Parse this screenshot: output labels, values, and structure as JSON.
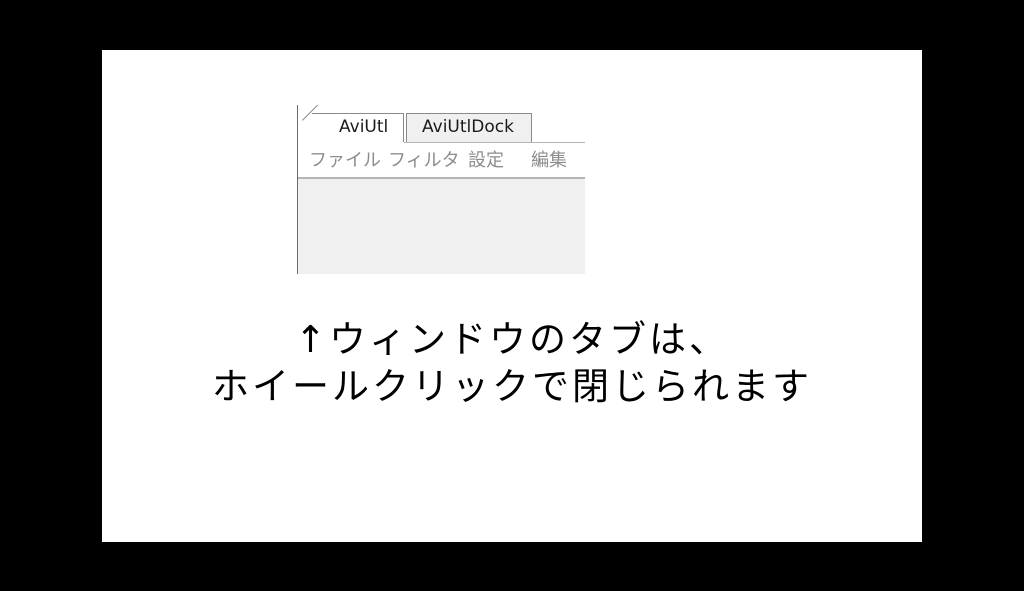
{
  "window": {
    "tabs": [
      {
        "label": "AviUtl",
        "active": true
      },
      {
        "label": "AviUtlDock",
        "active": false
      }
    ]
  },
  "menu": {
    "items": [
      {
        "label": "ファイル"
      },
      {
        "label": "フィルタ"
      },
      {
        "label": "設定"
      },
      {
        "label": "編集"
      }
    ]
  },
  "caption": {
    "line1": "↑ウィンドウのタブは、",
    "line2": "ホイールクリックで閉じられます"
  },
  "colors": {
    "background": "#000000",
    "frame": "#ffffff",
    "window_background": "#f0f0f0",
    "menu_text": "#8d8d8d",
    "caption_text": "#000000"
  }
}
